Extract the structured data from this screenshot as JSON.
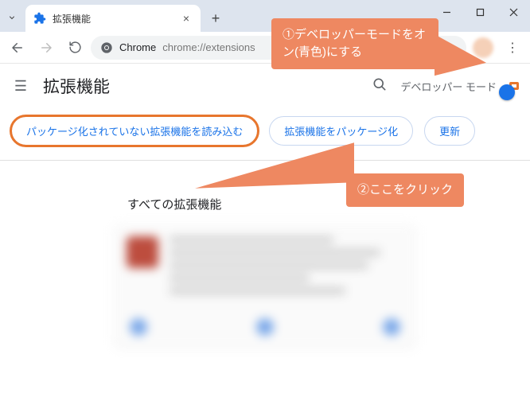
{
  "window": {
    "tab_title": "拡張機能",
    "url_host": "Chrome",
    "url_path": "chrome://extensions"
  },
  "toolbar": {
    "title": "拡張機能",
    "dev_mode_label": "デベロッパー モード"
  },
  "buttons": {
    "load_unpacked": "パッケージ化されていない拡張機能を読み込む",
    "pack": "拡張機能をパッケージ化",
    "update": "更新"
  },
  "section": {
    "all_extensions": "すべての拡張機能"
  },
  "annotations": {
    "a1": "①デベロッパーモードをオン(青色)にする",
    "a2": "②ここをクリック"
  }
}
